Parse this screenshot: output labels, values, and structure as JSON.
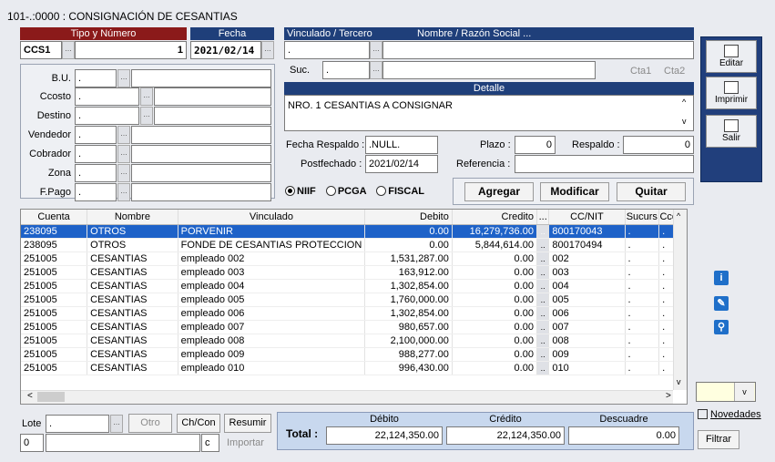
{
  "window": {
    "title": "101-.:0000 : CONSIGNACIÓN DE CESANTIAS"
  },
  "doc": {
    "tipo_header": "Tipo y Número",
    "tipo": "CCS1",
    "numero": "1",
    "fecha_header": "Fecha",
    "fecha": "2021/02/14",
    "vinculado_header": "Vinculado / Tercero",
    "nombre_header": "Nombre / Razón Social ...",
    "vinculado": ".",
    "suc_label": "Suc.",
    "suc": ".",
    "cta1": "Cta1",
    "cta2": "Cta2"
  },
  "left_fields": [
    {
      "label": "B.U.",
      "value": "."
    },
    {
      "label": "Ccosto",
      "value": "."
    },
    {
      "label": "Destino",
      "value": "."
    },
    {
      "label": "Vendedor",
      "value": "."
    },
    {
      "label": "Cobrador",
      "value": "."
    },
    {
      "label": "Zona",
      "value": "."
    },
    {
      "label": "F.Pago",
      "value": "."
    }
  ],
  "detalle": {
    "header": "Detalle",
    "text": "NRO. 1 CESANTIAS A CONSIGNAR"
  },
  "respaldo": {
    "fecha_label": "Fecha Respaldo :",
    "fecha_value": ".NULL.",
    "plazo_label": "Plazo :",
    "plazo_value": "0",
    "respaldo_label": "Respaldo :",
    "respaldo_value": "0",
    "post_label": "Postfechado :",
    "post_value": "2021/02/14",
    "ref_label": "Referencia :",
    "ref_value": ""
  },
  "radios": [
    {
      "label": "NIIF",
      "selected": true
    },
    {
      "label": "PCGA",
      "selected": false
    },
    {
      "label": "FISCAL",
      "selected": false
    }
  ],
  "actions": {
    "agregar": "Agregar",
    "modificar": "Modificar",
    "quitar": "Quitar"
  },
  "side_buttons": {
    "editar": "Editar",
    "imprimir": "Imprimir",
    "salir": "Salir"
  },
  "grid": {
    "columns": [
      "Cuenta",
      "Nombre",
      "Vinculado",
      "Debito",
      "Credito",
      "...",
      "CC/NIT",
      "Sucurs",
      "Ccost"
    ],
    "rows": [
      [
        "238095",
        "OTROS",
        "PORVENIR",
        "0.00",
        "16,279,736.00",
        "800170043",
        ".",
        "."
      ],
      [
        "238095",
        "OTROS",
        "FONDE DE CESANTIAS PROTECCION",
        "0.00",
        "5,844,614.00",
        "800170494",
        ".",
        "."
      ],
      [
        "251005",
        "CESANTIAS",
        "empleado 002",
        "1,531,287.00",
        "0.00",
        "002",
        ".",
        "."
      ],
      [
        "251005",
        "CESANTIAS",
        "empleado 003",
        "163,912.00",
        "0.00",
        "003",
        ".",
        "."
      ],
      [
        "251005",
        "CESANTIAS",
        "empleado 004",
        "1,302,854.00",
        "0.00",
        "004",
        ".",
        "."
      ],
      [
        "251005",
        "CESANTIAS",
        "empleado 005",
        "1,760,000.00",
        "0.00",
        "005",
        ".",
        "."
      ],
      [
        "251005",
        "CESANTIAS",
        "empleado 006",
        "1,302,854.00",
        "0.00",
        "006",
        ".",
        "."
      ],
      [
        "251005",
        "CESANTIAS",
        "empleado 007",
        "980,657.00",
        "0.00",
        "007",
        ".",
        "."
      ],
      [
        "251005",
        "CESANTIAS",
        "empleado 008",
        "2,100,000.00",
        "0.00",
        "008",
        ".",
        "."
      ],
      [
        "251005",
        "CESANTIAS",
        "empleado 009",
        "988,277.00",
        "0.00",
        "009",
        ".",
        "."
      ],
      [
        "251005",
        "CESANTIAS",
        "empleado 010",
        "996,430.00",
        "0.00",
        "010",
        ".",
        "."
      ]
    ]
  },
  "bottom": {
    "lote_label": "Lote",
    "lote_value": ".",
    "otro": "Otro",
    "chcon": "Ch/Con",
    "resumir": "Resumir",
    "counter": "0",
    "c": "c",
    "importar": "Importar",
    "total_label": "Total :",
    "debito_header": "Débito",
    "credito_header": "Crédito",
    "descuadre_header": "Descuadre",
    "debito": "22,124,350.00",
    "credito": "22,124,350.00",
    "descuadre": "0.00"
  },
  "right_panel": {
    "novedades": "Novedades",
    "filtrar": "Filtrar"
  },
  "colors": {
    "tipo_header": "#8b1a1a",
    "blue_header": "#1f3f7a",
    "selected_row": "#1e62c8"
  }
}
